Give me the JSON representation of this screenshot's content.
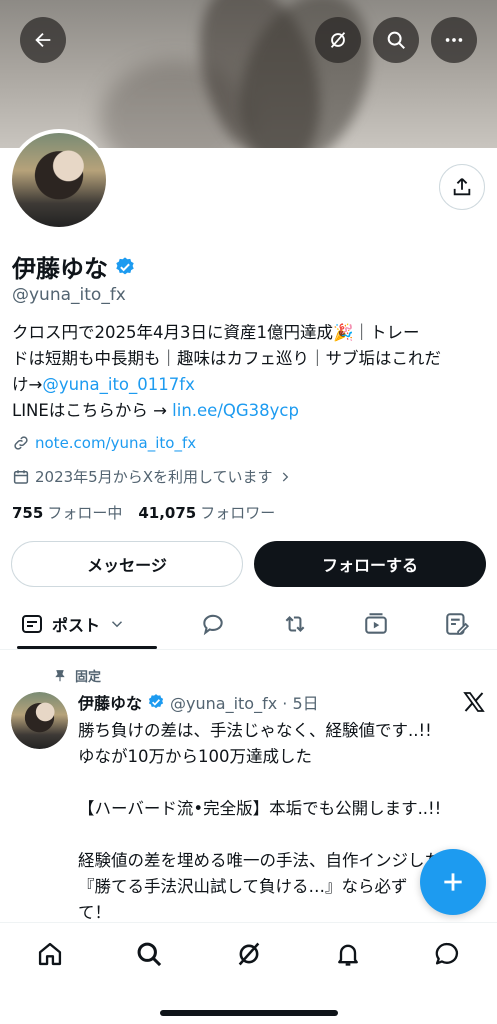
{
  "profile": {
    "name": "伊藤ゆな",
    "handle": "@yuna_ito_fx",
    "bio_line1_text": "クロス円で2025年4月3日に資産1億円達成",
    "bio_line1_emoji": "🎉",
    "bio_line1_rest": "｜トレー",
    "bio_line2": "ドは短期も中長期も｜趣味はカフェ巡り｜サブ垢はこれだ",
    "bio_line3_prefix": "け→",
    "bio_line3_link": "@yuna_ito_0117fx",
    "bio_line4_prefix": "LINEはこちらから → ",
    "bio_line4_link": "lin.ee/QG38ycp",
    "website": "note.com/yuna_ito_fx",
    "joined": "2023年5月からXを利用しています",
    "following_count": "755",
    "following_label": "フォロー中",
    "followers_count": "41,075",
    "followers_label": "フォロワー"
  },
  "actions": {
    "message_label": "メッセージ",
    "follow_label": "フォローする"
  },
  "tabs": {
    "posts_label": "ポスト"
  },
  "pinned_tweet": {
    "pinned_label": "固定",
    "author": "伊藤ゆな",
    "meta": "@yuna_ito_fx · 5日",
    "body": "勝ち負けの差は、手法じゃなく、経験値です..!!\nゆなが10万から100万達成した\n\n【ハーバード流•完全版】本垢でも公開します..!!\n\n経験値の差を埋める唯一の手法、自作インジした！\n『勝てる手法沢山試して負ける…』なら必ず\nて！"
  },
  "colors": {
    "accent": "#1d9bf0",
    "text": "#0f1419",
    "secondary": "#536471"
  }
}
